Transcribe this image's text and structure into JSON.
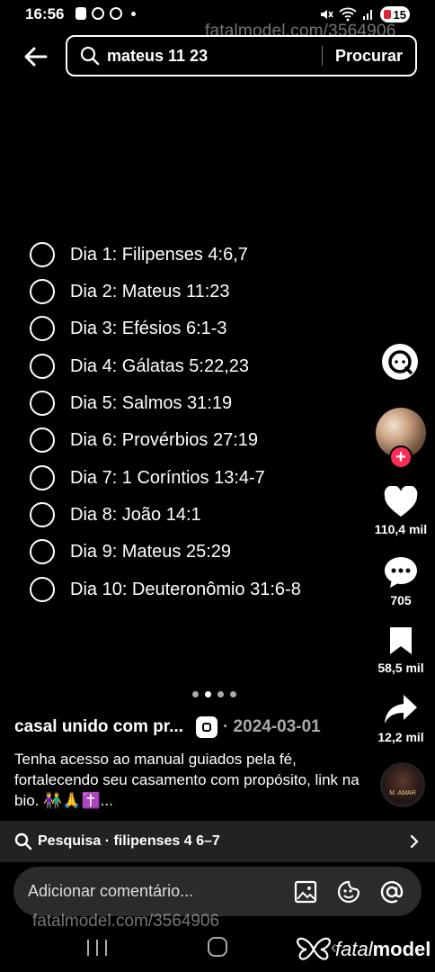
{
  "status_bar": {
    "time": "16:56",
    "battery": "15"
  },
  "watermark": {
    "top": "fatalmodel.com/3564906",
    "bottom": "fatalmodel.com/3564906"
  },
  "search": {
    "query": "mateus 11 23",
    "submit_label": "Procurar"
  },
  "checklist": {
    "items": [
      {
        "label": "Dia 1: Filipenses 4:6,7"
      },
      {
        "label": "Dia 2: Mateus 11:23"
      },
      {
        "label": "Dia 3: Efésios 6:1-3"
      },
      {
        "label": "Dia 4: Gálatas 5:22,23"
      },
      {
        "label": "Dia 5: Salmos 31:19"
      },
      {
        "label": "Dia 6: Provérbios 27:19"
      },
      {
        "label": "Dia 7: 1 Coríntios 13:4-7"
      },
      {
        "label": "Dia 8: João 14:1"
      },
      {
        "label": "Dia 9: Mateus 25:29"
      },
      {
        "label": "Dia 10: Deuteronômio 31:6-8"
      }
    ]
  },
  "rail": {
    "likes": "110,4 mil",
    "comments": "705",
    "saves": "58,5 mil",
    "shares": "12,2 mil",
    "music_disc_text": "M. AMAR"
  },
  "carousel": {
    "count": 4,
    "active_index": 1
  },
  "post": {
    "username": "casal unido com pr...",
    "date": "· 2024-03-01",
    "caption": "Tenha acesso ao manual guiados pela fé, fortalecendo seu casamento com propósito, link na bio. 👫🙏✝️..."
  },
  "related_search": {
    "label": "Pesquisa · filipenses 4 6–7"
  },
  "comment_bar": {
    "placeholder": "Adicionar comentário..."
  },
  "brand": {
    "name_light": "fatal",
    "name_bold": "model"
  },
  "colors": {
    "background": "#000000",
    "accent_red": "#fe2c55",
    "bar_gray": "#222222",
    "input_gray": "#2b2b2b"
  }
}
